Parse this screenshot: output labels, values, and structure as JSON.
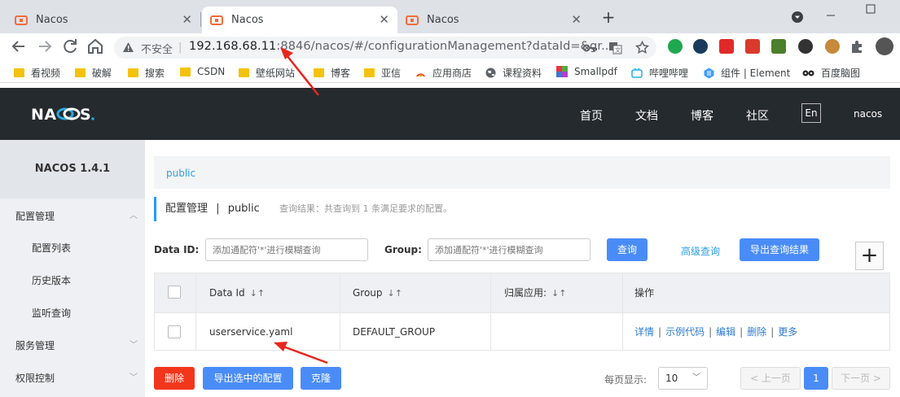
{
  "browser": {
    "tabs": [
      {
        "title": "Nacos",
        "close": "✕"
      },
      {
        "title": "Nacos",
        "close": "✕"
      },
      {
        "title": "Nacos",
        "close": "✕"
      }
    ],
    "new_tab": "+",
    "omnibox": {
      "security_label": "不安全",
      "separator": "|",
      "url_host": "192.168.68.11",
      "url_rest": ":8846/nacos/#/configurationManagement?dataId=&gr..."
    },
    "bookmarks": [
      "看视频",
      "破解",
      "搜索",
      "CSDN",
      "壁纸网站",
      "博客",
      "亚信",
      "应用商店",
      "课程资料",
      "Smallpdf",
      "哔哩哔哩",
      "组件 | Element",
      "百度脑图"
    ]
  },
  "nacos": {
    "logo": "NACOS.",
    "nav": [
      "首页",
      "文档",
      "博客",
      "社区"
    ],
    "lang": "En",
    "user": "nacos"
  },
  "sidebar": {
    "title": "NACOS 1.4.1",
    "items": [
      {
        "label": "配置管理",
        "chevron": "︿"
      },
      {
        "label": "配置列表"
      },
      {
        "label": "历史版本"
      },
      {
        "label": "监听查询"
      },
      {
        "label": "服务管理",
        "chevron": "﹀"
      },
      {
        "label": "权限控制",
        "chevron": "﹀"
      }
    ]
  },
  "main": {
    "namespace": "public",
    "title": "配置管理",
    "title_sep": "|",
    "title_ns": "public",
    "query_result": "查询结果：共查询到 1 条满足要求的配置。",
    "dataid_label": "Data ID:",
    "dataid_placeholder": "添加通配符'*'进行模糊查询",
    "group_label": "Group:",
    "group_placeholder": "添加通配符'*'进行模糊查询",
    "query_btn": "查询",
    "advanced_query": "高级查询",
    "export_btn": "导出查询结果",
    "add_btn": "+"
  },
  "table": {
    "headers": [
      "Data Id",
      "Group",
      "归属应用:",
      "操作"
    ],
    "sort_icon": "↓↑",
    "rows": [
      {
        "data_id": "userservice.yaml",
        "group": "DEFAULT_GROUP",
        "app": "",
        "ops": [
          "详情",
          "示例代码",
          "编辑",
          "删除",
          "更多"
        ]
      }
    ],
    "op_sep": "|"
  },
  "footer": {
    "delete_btn": "删除",
    "export_selected_btn": "导出选中的配置",
    "clone_btn": "克隆",
    "page_size_label": "每页显示:",
    "page_size": "10",
    "dropdown_icon": "﹀",
    "prev": "< 上一页",
    "current_page": "1",
    "next": "下一页 >"
  },
  "colors": {
    "header_bg": "#252a2f",
    "primary": "#4a8cf7",
    "danger": "#f1361c",
    "link": "#2e9fe2",
    "annotation_arrow": "#e8261c"
  }
}
